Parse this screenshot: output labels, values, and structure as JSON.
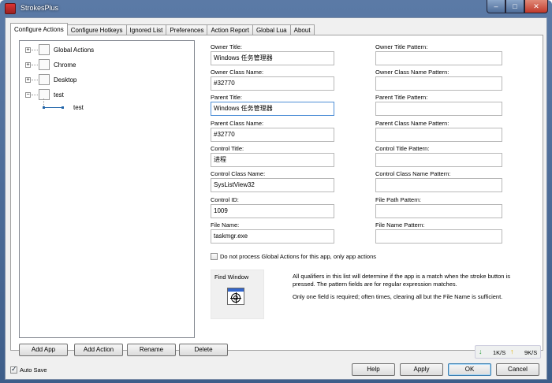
{
  "window": {
    "title": "StrokesPlus",
    "minimize_glyph": "–",
    "maximize_glyph": "□",
    "close_glyph": "✕"
  },
  "tabs": [
    "Configure Actions",
    "Configure Hotkeys",
    "Ignored List",
    "Preferences",
    "Action Report",
    "Global Lua",
    "About"
  ],
  "tree": {
    "items": [
      {
        "label": "Global Actions",
        "expander": "+"
      },
      {
        "label": "Chrome",
        "expander": "+"
      },
      {
        "label": "Desktop",
        "expander": "+"
      },
      {
        "label": "test",
        "expander": "−"
      }
    ],
    "child": {
      "label": "test"
    }
  },
  "fields": {
    "owner_title": {
      "label": "Owner Title:",
      "value": "Windows 任务管理器"
    },
    "owner_title_pattern": {
      "label": "Owner Title Pattern:",
      "value": ""
    },
    "owner_class_name": {
      "label": "Owner Class Name:",
      "value": "#32770"
    },
    "owner_class_name_pattern": {
      "label": "Owner Class Name Pattern:",
      "value": ""
    },
    "parent_title": {
      "label": "Parent Title:",
      "value": "Windows 任务管理器"
    },
    "parent_title_pattern": {
      "label": "Parent Title Pattern:",
      "value": ""
    },
    "parent_class_name": {
      "label": "Parent Class Name:",
      "value": "#32770"
    },
    "parent_class_name_pattern": {
      "label": "Parent Class Name Pattern:",
      "value": ""
    },
    "control_title": {
      "label": "Control Title:",
      "value": "进程"
    },
    "control_title_pattern": {
      "label": "Control Title Pattern:",
      "value": ""
    },
    "control_class_name": {
      "label": "Control Class Name:",
      "value": "SysListView32"
    },
    "control_class_name_pattern": {
      "label": "Control Class Name Pattern:",
      "value": ""
    },
    "control_id": {
      "label": "Control ID:",
      "value": "1009"
    },
    "file_path_pattern": {
      "label": "File Path Pattern:",
      "value": ""
    },
    "file_name": {
      "label": "File Name:",
      "value": "taskmgr.exe"
    },
    "file_name_pattern": {
      "label": "File Name Pattern:",
      "value": ""
    }
  },
  "no_global_checkbox": {
    "label": "Do not process Global Actions for this app, only app actions",
    "checked": false
  },
  "find_window": {
    "title": "Find Window",
    "icon": "crosshair-target-icon"
  },
  "info": {
    "line1": "All qualifiers in this list will determine if the app is a match when the stroke button is",
    "line2": "pressed. The pattern fields are for regular expression matches.",
    "line3": "Only one field is required; often times, clearing all but the File Name is sufficient."
  },
  "buttons": {
    "add_app": "Add App",
    "add_action": "Add Action",
    "rename": "Rename",
    "delete": "Delete",
    "help": "Help",
    "apply": "Apply",
    "ok": "OK",
    "cancel": "Cancel"
  },
  "auto_save": {
    "label": "Auto Save",
    "checked": true
  },
  "netmon": {
    "down_arrow": "↓",
    "down": "1K/S",
    "up_arrow": "↑",
    "up": "9K/S"
  },
  "colors": {
    "accent": "#3c7fb1",
    "down_arrow": "#2a9d3a",
    "up_arrow": "#e0b000"
  }
}
